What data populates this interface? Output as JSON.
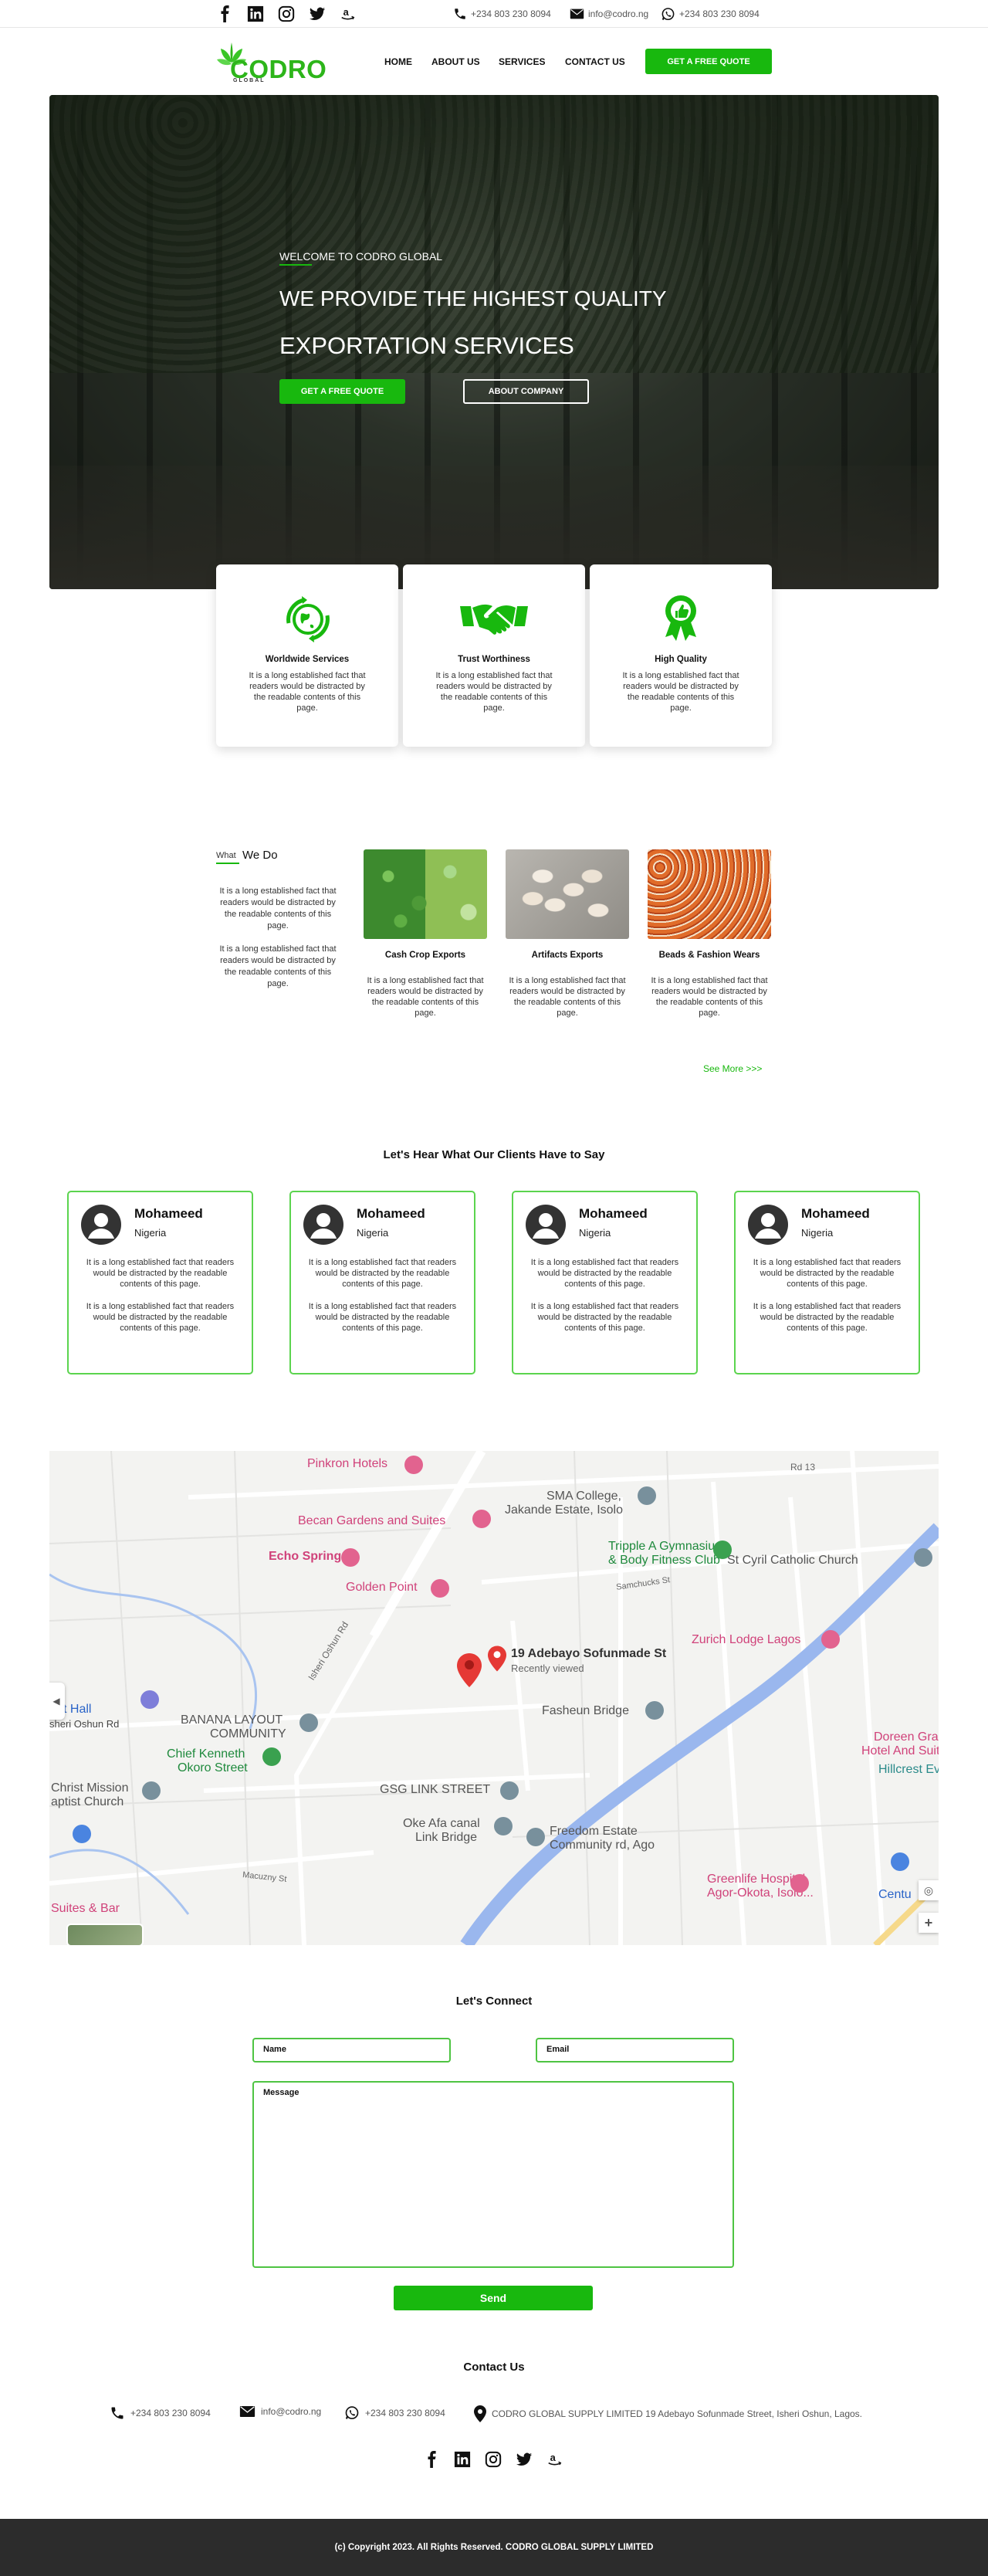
{
  "topbar": {
    "social_icons": [
      "facebook-icon",
      "linkedin-icon",
      "instagram-icon",
      "twitter-icon",
      "amazon-icon"
    ],
    "phone": "+234 803 230 8094",
    "email": "info@codro.ng",
    "whatsapp": "+234 803 230 8094"
  },
  "nav": {
    "logo_text": "CODRO",
    "logo_sub": "GLOBAL",
    "links": [
      "HOME",
      "ABOUT US",
      "SERVICES",
      "CONTACT US"
    ],
    "cta": "GET A FREE QUOTE"
  },
  "hero": {
    "eyebrow": "WELCOME TO CODRO GLOBAL",
    "title_line1": "WE PROVIDE THE HIGHEST QUALITY",
    "title_line2": "EXPORTATION SERVICES",
    "primary_button": "GET A FREE QUOTE",
    "secondary_button": "ABOUT COMPANY"
  },
  "features": [
    {
      "icon": "globe-icon",
      "title": "Worldwide Services",
      "text": "It is a long established fact that readers would be distracted by the readable contents of this page."
    },
    {
      "icon": "handshake-icon",
      "title": "Trust Worthiness",
      "text": "It is a long established fact that readers would be distracted by the readable contents of this page."
    },
    {
      "icon": "award-badge-icon",
      "title": "High Quality",
      "text": "It is a long established fact that readers would be distracted by the readable contents of this page."
    }
  ],
  "what_we_do": {
    "heading_small": "What",
    "heading": "We Do",
    "para1": "It is a long established fact that readers would be distracted by the readable contents of this page.",
    "para2": "It is a long established fact that readers would be distracted by the readable contents of this page.",
    "products": [
      {
        "title": "Cash Crop Exports",
        "text": "It is a long established fact that readers would be distracted by the readable contents of this page."
      },
      {
        "title": "Artifacts Exports",
        "text": "It is a long established fact that readers would be distracted by the readable contents of this page."
      },
      {
        "title": "Beads & Fashion Wears",
        "text": "It is a long established fact that readers would be distracted by the readable contents of this page."
      }
    ],
    "see_more": "See More >>>"
  },
  "testimonials": {
    "heading": "Let's  Hear What Our Clients Have to Say",
    "items": [
      {
        "name": "Mohameed",
        "location": "Nigeria",
        "p1": "It is a long established fact that readers would be distracted by the readable contents of this page.",
        "p2": "It is a long established fact that readers would be distracted by the readable contents of this page."
      },
      {
        "name": "Mohameed",
        "location": "Nigeria",
        "p1": "It is a long established fact that readers would be distracted by the readable contents of this page.",
        "p2": "It is a long established fact that readers would be distracted by the readable contents of this page."
      },
      {
        "name": "Mohameed",
        "location": "Nigeria",
        "p1": "It is a long established fact that readers would be distracted by the readable contents of this page.",
        "p2": "It is a long established fact that readers would be distracted by the readable contents of this page."
      },
      {
        "name": "Mohameed",
        "location": "Nigeria",
        "p1": "It is a long established fact that readers would be distracted by the readable contents of this page.",
        "p2": "It is a long established fact that readers would be distracted by the readable contents of this page."
      }
    ]
  },
  "map": {
    "labels": {
      "pinkron": "Pinkron Hotels",
      "sma": "SMA College,",
      "jakande": "Jakande Estate, Isolo",
      "becan": "Becan Gardens and Suites",
      "echo": "Echo Spring",
      "golden": "Golden Point",
      "tripple1": "Tripple A Gymnasium",
      "tripple2": "& Body Fitness Club",
      "stcyril": "St Cyril Catholic Church",
      "address": "19 Adebayo Sofunmade St",
      "recent": "Recently viewed",
      "zurich": "Zurich Lodge Lagos",
      "hall": "t Hall",
      "isheri": "sheri Oshun Rd",
      "banana1": "BANANA LAYOUT",
      "banana2": "COMMUNITY",
      "fasheun": "Fasheun Bridge",
      "doreen1": "Doreen Grand",
      "doreen2": "Hotel And Suites",
      "hillcrest": "Hillcrest Events C",
      "chief1": "Chief Kenneth",
      "chief2": "Okoro Street",
      "christ1": "Christ Mission",
      "christ2": "aptist Church",
      "gsg": "GSG LINK STREET",
      "okeafa1": "Oke Afa canal",
      "okeafa2": "Link Bridge",
      "freedom1": "Freedom Estate",
      "freedom2": "Community rd, Ago",
      "greenlife1": "Greenlife Hospital",
      "greenlife2": "Agor-Okota, Isolo...",
      "suites": "Suites & Bar",
      "centu": "Centu",
      "rd13": "Rd 13",
      "isherirad": "Isheri Oshun Rd",
      "samchuks": "Samchucks St",
      "macuzny": "Macuzny St"
    }
  },
  "contact_form": {
    "heading": "Let's Connect",
    "name_placeholder": "Name",
    "email_placeholder": "Email",
    "message_placeholder": "Message",
    "send": "Send"
  },
  "contact_us": {
    "heading": "Contact Us",
    "phone": "+234 803 230 8094",
    "email": "info@codro.ng",
    "whatsapp": "+234 803 230 8094",
    "address": "CODRO GLOBAL SUPPLY LIMITED 19 Adebayo Sofunmade Street, Isheri Oshun, Lagos."
  },
  "footer": {
    "copyright": "(c) Copyright 2023. All Rights Reserved.  CODRO GLOBAL SUPPLY LIMITED"
  },
  "colors": {
    "brand_green": "#18b80e",
    "border_green": "#4ec442",
    "footer_bg": "#2c2c2c"
  }
}
